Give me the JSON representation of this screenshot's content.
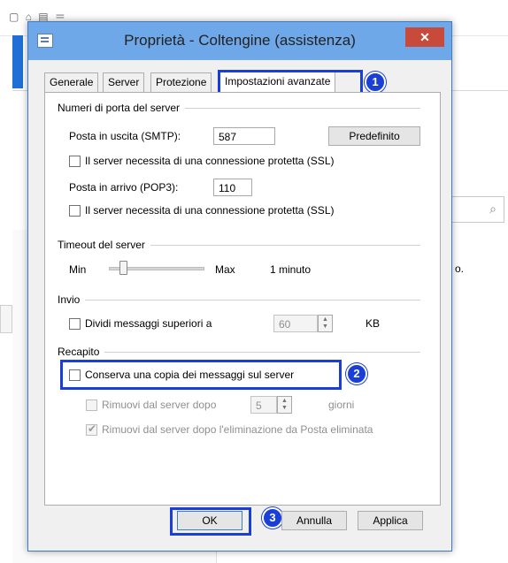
{
  "dialog": {
    "title": "Proprietà - Coltengine (assistenza)",
    "close_label": "✕"
  },
  "tabs": [
    "Generale",
    "Server",
    "Protezione",
    "Impostazioni avanzate"
  ],
  "callouts": [
    "1",
    "2",
    "3"
  ],
  "ports": {
    "group_label": "Numeri di porta del server",
    "smtp_label": "Posta in uscita (SMTP):",
    "smtp_value": "587",
    "default_button": "Predefinito",
    "smtp_ssl_label": "Il server necessita di una connessione protetta (SSL)",
    "pop3_label": "Posta in arrivo (POP3):",
    "pop3_value": "110",
    "pop3_ssl_label": "Il server necessita di una connessione protetta (SSL)"
  },
  "timeout": {
    "group_label": "Timeout del server",
    "min_label": "Min",
    "max_label": "Max",
    "value_label": "1 minuto",
    "level": 0.12
  },
  "send": {
    "group_label": "Invio",
    "split_label": "Dividi messaggi superiori a",
    "split_value": "60",
    "unit": "KB"
  },
  "delivery": {
    "group_label": "Recapito",
    "keep_copy_label": "Conserva una copia dei messaggi sul server",
    "remove_after_label": "Rimuovi dal server dopo",
    "remove_after_value": "5",
    "remove_after_unit": "giorni",
    "remove_deleted_label": "Rimuovi dal server dopo l'eliminazione da Posta eliminata"
  },
  "buttons": {
    "ok": "OK",
    "cancel": "Annulla",
    "apply": "Applica"
  },
  "background": {
    "snippet": "o.",
    "search_icon": "⌕"
  },
  "colors": {
    "highlight": "#1a3fd8",
    "titlebar": "#6fa8e8",
    "close": "#c74a3a"
  }
}
